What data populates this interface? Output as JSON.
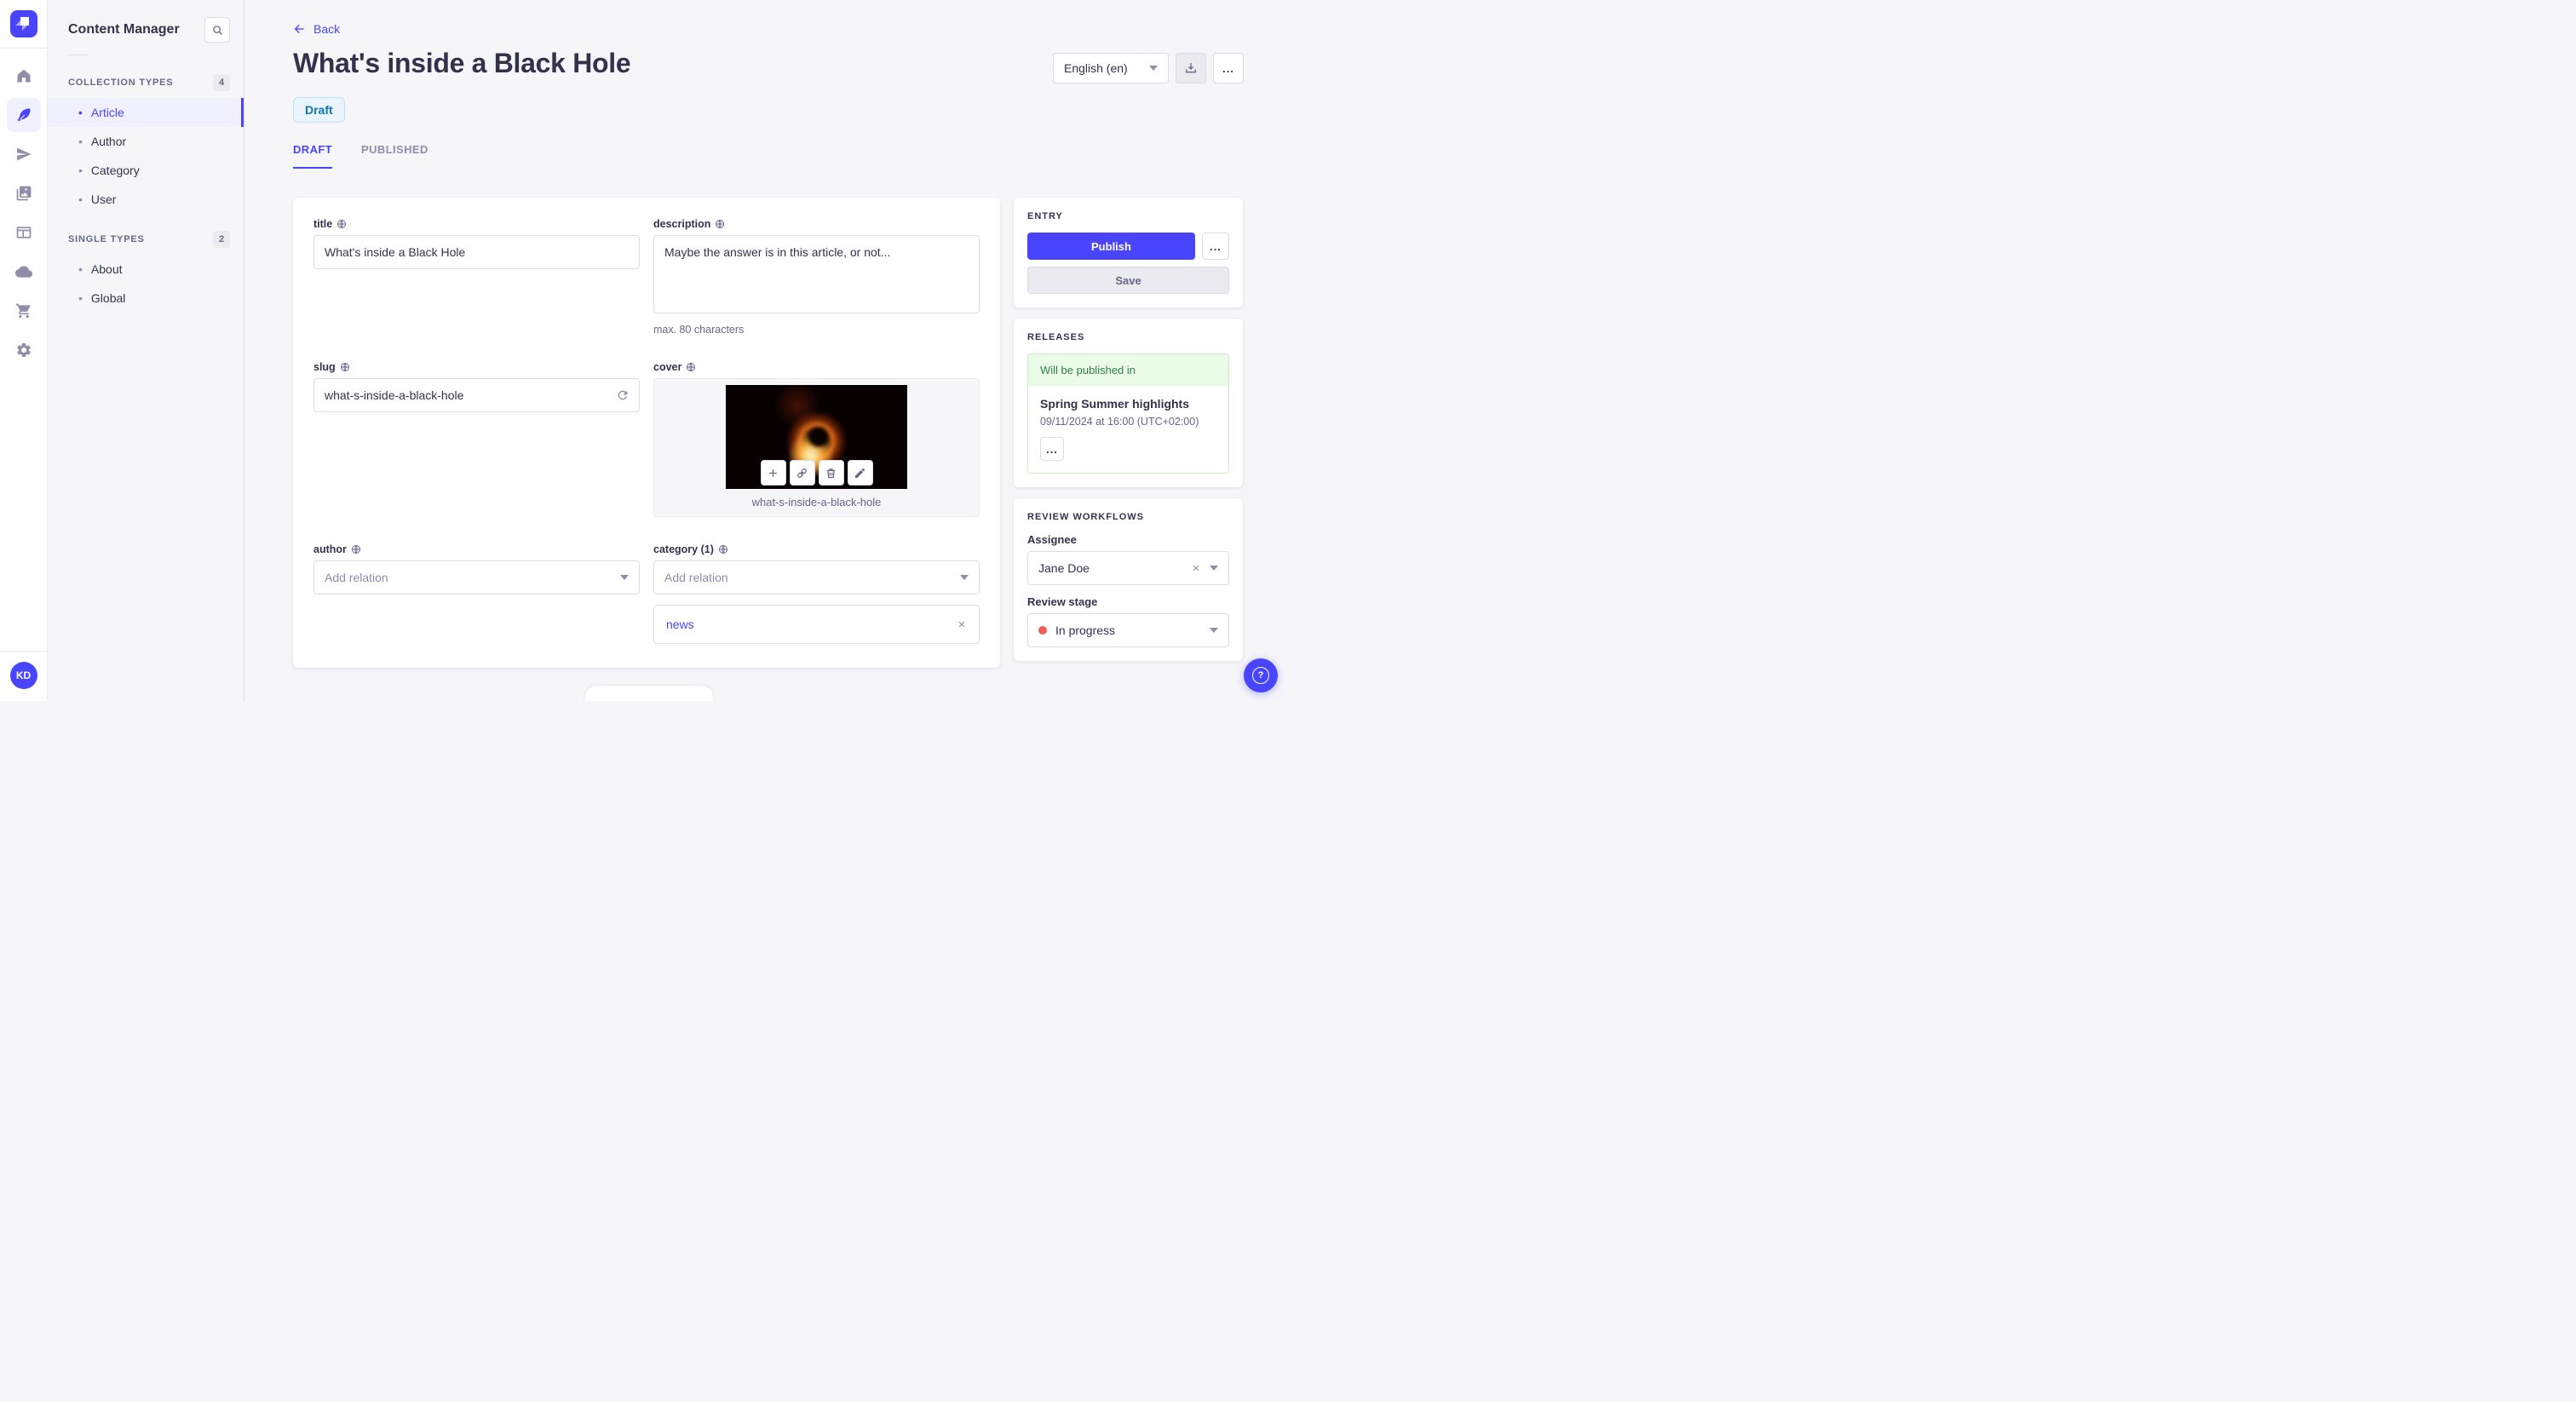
{
  "app": {
    "help": "?",
    "avatar": "KD",
    "more_dots": "..."
  },
  "colors": {
    "primary": "#4945ff",
    "draft_bg": "#eaf5ff",
    "draft_border": "#b8e1ff",
    "draft_text": "#0c75af",
    "success_bg": "#eafbe7",
    "success_border": "#c6f0c2",
    "success_text": "#328048",
    "stage_dot": "#ee5e52"
  },
  "subnav": {
    "title": "Content Manager",
    "collection_header": "COLLECTION TYPES",
    "collection_count": "4",
    "collection_items": [
      {
        "label": "Article"
      },
      {
        "label": "Author"
      },
      {
        "label": "Category"
      },
      {
        "label": "User"
      }
    ],
    "single_header": "SINGLE TYPES",
    "single_count": "2",
    "single_items": [
      {
        "label": "About"
      },
      {
        "label": "Global"
      }
    ]
  },
  "header": {
    "back": "Back",
    "title": "What's inside a Black Hole",
    "status": "Draft",
    "locale": "English (en)",
    "tabs": [
      {
        "label": "DRAFT"
      },
      {
        "label": "PUBLISHED"
      }
    ]
  },
  "form": {
    "title": {
      "label": "title",
      "value": "What's inside a Black Hole"
    },
    "description": {
      "label": "description",
      "value": "Maybe the answer is in this article, or not...",
      "helper": "max. 80 characters"
    },
    "slug": {
      "label": "slug",
      "value": "what-s-inside-a-black-hole"
    },
    "cover": {
      "label": "cover",
      "caption": "what-s-inside-a-black-hole"
    },
    "author": {
      "label": "author",
      "placeholder": "Add relation"
    },
    "category": {
      "label": "category (1)",
      "placeholder": "Add relation",
      "relation": "news"
    }
  },
  "entry": {
    "title": "ENTRY",
    "publish": "Publish",
    "save": "Save"
  },
  "releases": {
    "title": "RELEASES",
    "status": "Will be published in",
    "name": "Spring Summer highlights",
    "date": "09/11/2024 at 16:00 (UTC+02:00)"
  },
  "review": {
    "title": "REVIEW WORKFLOWS",
    "assignee_label": "Assignee",
    "assignee": "Jane Doe",
    "stage_label": "Review stage",
    "stage": "In progress"
  }
}
